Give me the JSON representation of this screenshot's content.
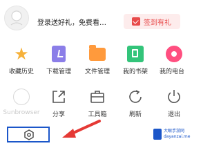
{
  "header": {
    "login_text": "登录送好礼，免费看…",
    "signin_label": "签到有礼"
  },
  "row1": [
    {
      "label": "收藏历史",
      "icon": "star-icon"
    },
    {
      "label": "下载管理",
      "icon": "download-icon"
    },
    {
      "label": "文件管理",
      "icon": "folder-icon"
    },
    {
      "label": "我的书架",
      "icon": "bookshelf-icon"
    },
    {
      "label": "我的电台",
      "icon": "radio-icon"
    }
  ],
  "row2": [
    {
      "label": "Sunbrowser",
      "icon": "browser-icon"
    },
    {
      "label": "分享",
      "icon": "share-icon"
    },
    {
      "label": "工具箱",
      "icon": "toolbox-icon"
    },
    {
      "label": "刷新",
      "icon": "refresh-icon"
    },
    {
      "label": "退出",
      "icon": "power-icon"
    }
  ],
  "bottom": {
    "settings_icon": "settings-icon"
  },
  "watermark": {
    "line1": "大眼手游网",
    "line2": "dayanzai.me"
  },
  "colors": {
    "accent_red": "#e84a4a",
    "annotation_blue": "#1b56c9",
    "arrow_red": "#e53935"
  }
}
